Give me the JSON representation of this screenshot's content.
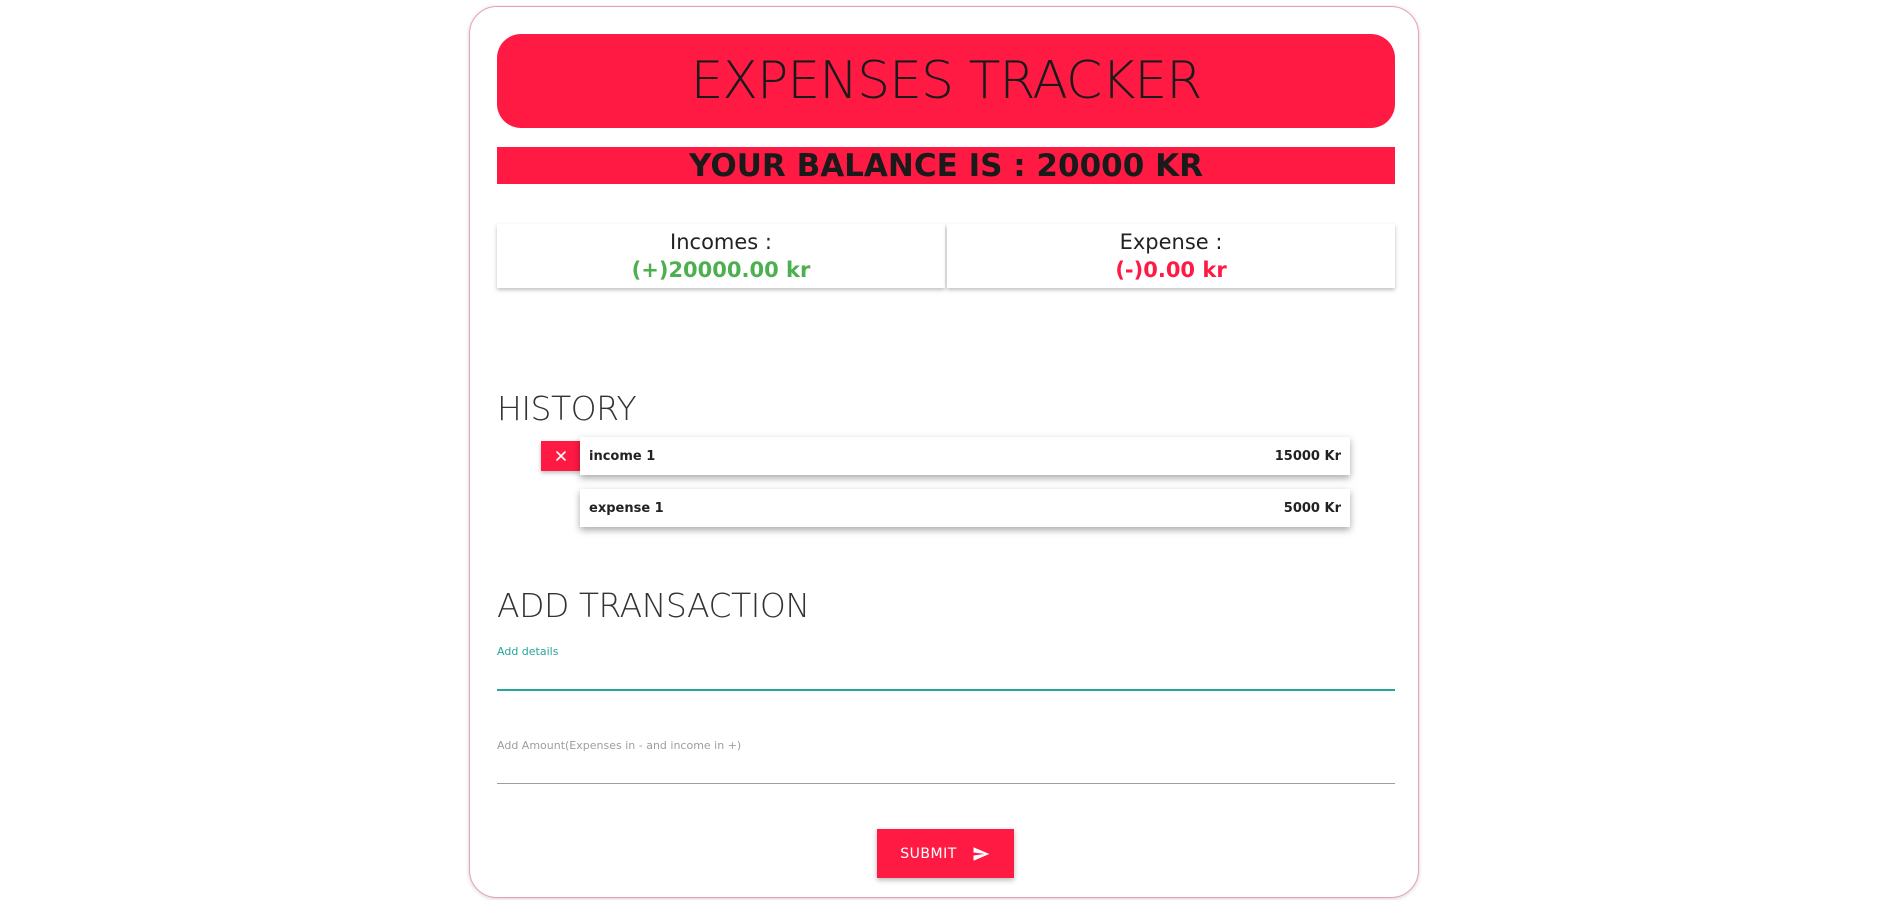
{
  "header": {
    "title": "EXPENSES TRACKER"
  },
  "balance": {
    "text": "YOUR BALANCE IS : 20000 KR"
  },
  "summary": {
    "income_label": "Incomes :",
    "income_value": "(+)20000.00 kr",
    "expense_label": "Expense :",
    "expense_value": "(-)0.00 kr"
  },
  "history": {
    "title": "HISTORY",
    "delete_icon": "close-icon",
    "items": [
      {
        "label": "income 1",
        "amount": "15000 Kr"
      },
      {
        "label": "expense 1",
        "amount": "5000 Kr"
      }
    ]
  },
  "add_transaction": {
    "title": "ADD TRANSACTION",
    "details_label": "Add details",
    "details_value": "",
    "amount_label": "Add Amount(Expenses in - and income in +)",
    "amount_value": "",
    "submit_label": "SUBMIT",
    "submit_icon": "send-icon"
  },
  "colors": {
    "accent": "#ff1a44",
    "income": "#4caf50",
    "expense": "#ff1a44",
    "input_focus": "#26a69a"
  }
}
